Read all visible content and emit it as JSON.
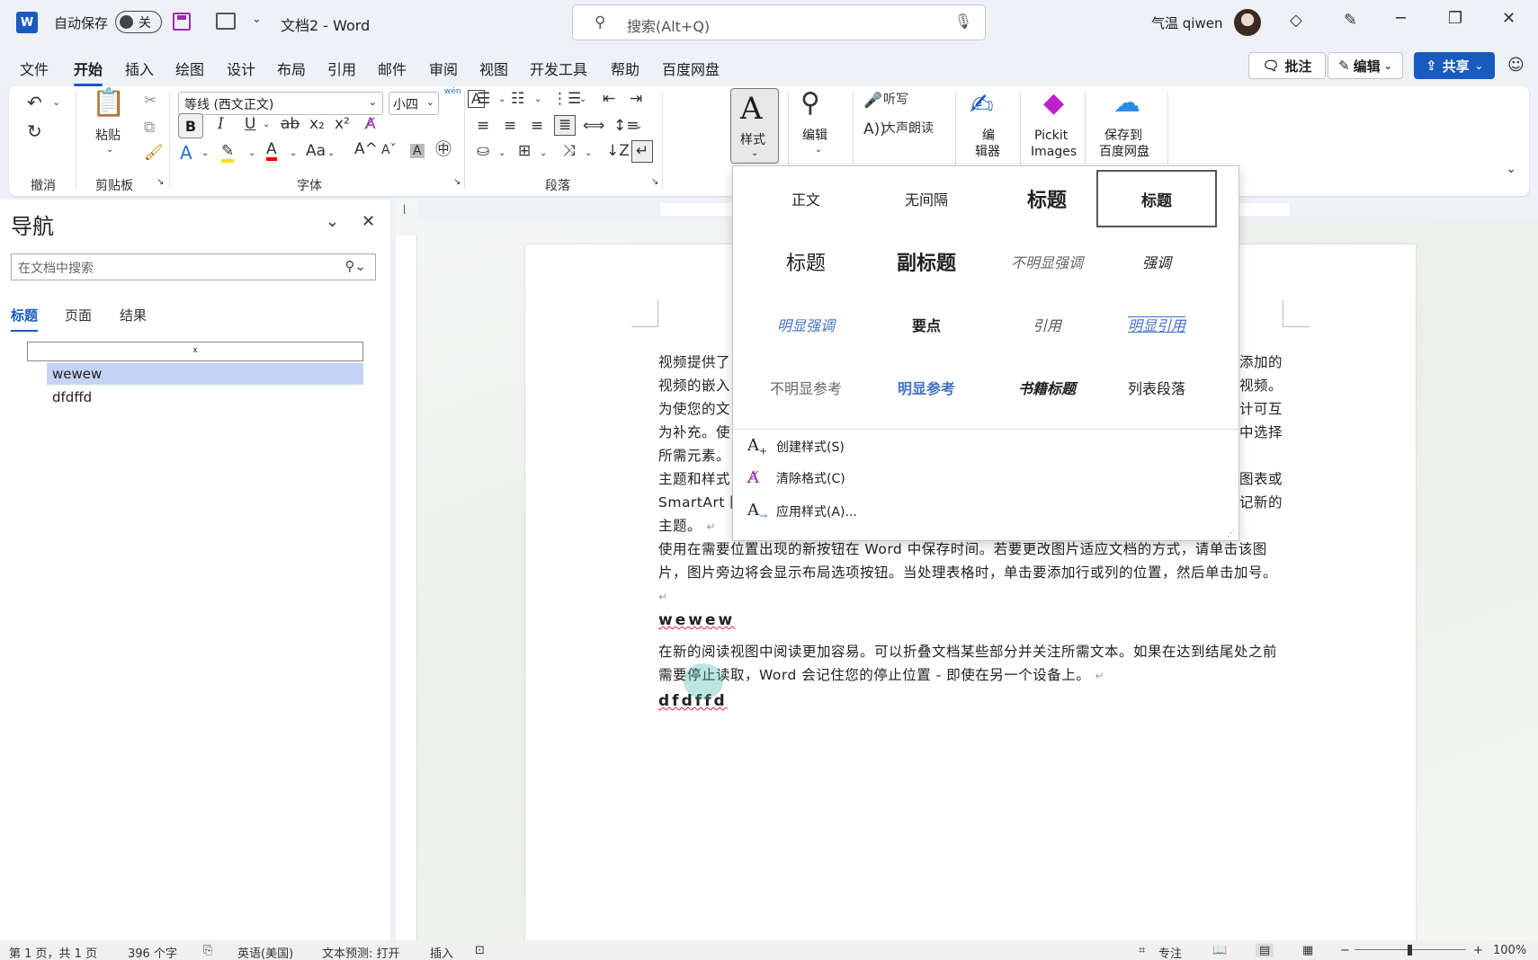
{
  "titlebar": {
    "app_icon": "W",
    "autosave_label": "自动保存",
    "autosave_state": "关",
    "doc_title": "文档2  -  Word",
    "search_placeholder": "搜索(Alt+Q)",
    "user_name": "气温 qiwen"
  },
  "menu": {
    "tabs": [
      "文件",
      "开始",
      "插入",
      "绘图",
      "设计",
      "布局",
      "引用",
      "邮件",
      "审阅",
      "视图",
      "开发工具",
      "帮助",
      "百度网盘"
    ],
    "active_tab": "开始",
    "comment_btn": "批注",
    "edit_btn": "编辑",
    "share_btn": "共享"
  },
  "ribbon": {
    "groups": {
      "undo": "撤消",
      "clipboard": "剪贴板",
      "font": "字体",
      "paragraph": "段落"
    },
    "paste_label": "粘贴",
    "font_name": "等线 (西文正文)",
    "font_size": "小四",
    "phonetic_label": "wén",
    "styles_label": "样式",
    "edit_label": "编辑",
    "dictate_label": "听写",
    "read_aloud_label": "大声朗读",
    "editor_label_1": "编",
    "editor_label_2": "辑器",
    "pickit_label_1": "Pickit",
    "pickit_label_2": "Images",
    "baidu_label_1": "保存到",
    "baidu_label_2": "百度网盘"
  },
  "styles_gallery": {
    "styles": [
      "正文",
      "无间隔",
      "标题",
      "标题",
      "标题",
      "副标题",
      "不明显强调",
      "强调",
      "明显强调",
      "要点",
      "引用",
      "明显引用",
      "不明显参考",
      "明显参考",
      "书籍标题",
      "列表段落"
    ],
    "selected_index": 3,
    "actions": [
      "创建样式(S)",
      "清除格式(C)",
      "应用样式(A)..."
    ]
  },
  "navigation": {
    "title": "导航",
    "search_placeholder": "在文档中搜索",
    "tabs": [
      "标题",
      "页面",
      "结果"
    ],
    "active_tab": "标题",
    "collapsed_marker": "x",
    "headings": [
      "wewew",
      "dfdffd"
    ],
    "selected_heading": "wewew"
  },
  "document": {
    "para1_lines": [
      "视频提供了",
      "视频的嵌入",
      "为使您的文",
      "为补充。使",
      "所需元素。"
    ],
    "para1_right": [
      "添加的",
      "的视频。",
      "计可互",
      "中选择",
      ""
    ],
    "para2_lines": [
      "主题和样式",
      "SmartArt 图",
      "主题。"
    ],
    "para2_right": [
      "图表或",
      "记新的",
      ""
    ],
    "para3": "使用在需要位置出现的新按钮在 Word 中保存时间。若要更改图片适应文档的方式，请单击该图片，图片旁边将会显示布局选项按钮。当处理表格时，单击要添加行或列的位置，然后单击加号。",
    "heading1": "wewew",
    "para4": "在新的阅读视图中阅读更加容易。可以折叠文档某些部分并关注所需文本。如果在达到结尾处之前需要停止读取，Word 会记住您的停止位置 - 即使在另一个设备上。",
    "heading2": "dfdffd"
  },
  "statusbar": {
    "page": "第 1 页，共 1 页",
    "words": "396 个字",
    "language": "英语(美国)",
    "prediction": "文本预测: 打开",
    "insert_mode": "插入",
    "focus": "专注",
    "zoom": "100%"
  }
}
